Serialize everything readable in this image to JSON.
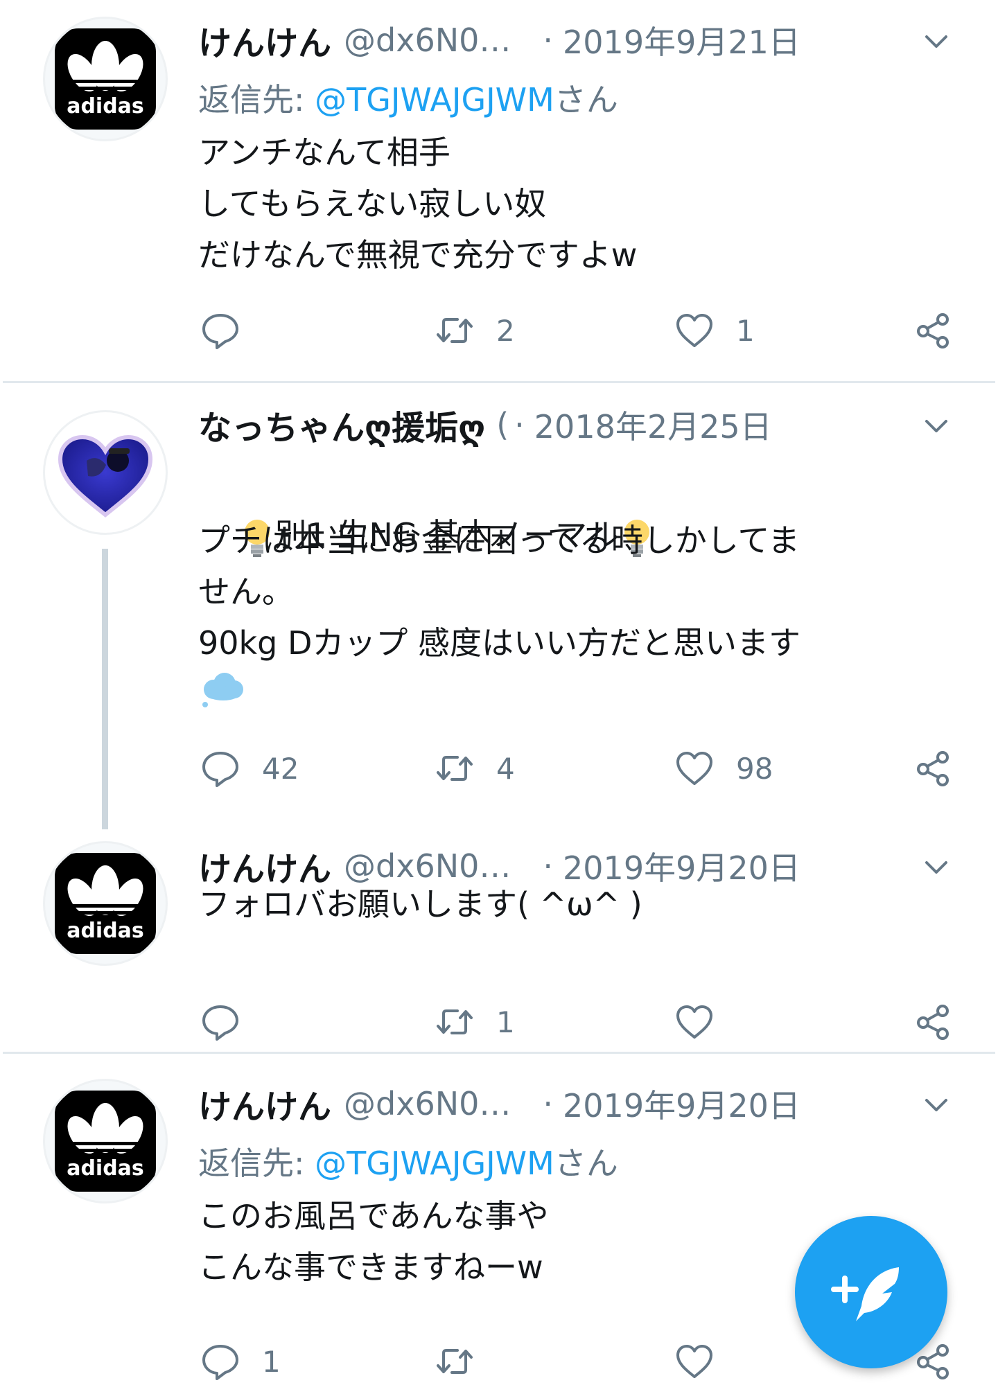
{
  "tweets": [
    {
      "name": "けんけん",
      "handle": "@dx6N0…",
      "dot": "·",
      "date": "2019年9月21日",
      "reply_prefix": "返信先: ",
      "reply_mention": "@TGJWAJGJWM",
      "reply_suffix": "さん",
      "text": "アンチなんて相手\nしてもらえない寂しい奴\nだけなんで無視で充分ですよw",
      "replies": "",
      "retweets": "2",
      "likes": "1",
      "avatar_text": "adidas"
    },
    {
      "name": "なっちゃんღ援垢ღ",
      "handle": "(",
      "dot": "·",
      "date": "2018年2月25日",
      "line1": "別1 生NG 基本ノーマル",
      "text": "プチは本当にお金に困ってる時しかしてま\nせん。\n90kg Dカップ 感度はいい方だと思います",
      "replies": "42",
      "retweets": "4",
      "likes": "98"
    },
    {
      "name": "けんけん",
      "handle": "@dx6N0…",
      "dot": "·",
      "date": "2019年9月20日",
      "text": "フォロバお願いします( ^ω^ )",
      "replies": "",
      "retweets": "1",
      "likes": "",
      "avatar_text": "adidas"
    },
    {
      "name": "けんけん",
      "handle": "@dx6N0…",
      "dot": "·",
      "date": "2019年9月20日",
      "reply_prefix": "返信先: ",
      "reply_mention": "@TGJWAJGJWM",
      "reply_suffix": "さん",
      "text": "このお風呂であんな事や\nこんな事できますねーw",
      "replies": "1",
      "retweets": "",
      "likes": "",
      "avatar_text": "adidas"
    }
  ],
  "icons": {
    "reply": "speech-bubble-icon",
    "retweet": "retweet-icon",
    "like": "heart-icon",
    "share": "share-icon",
    "more": "chevron-down-icon",
    "compose": "compose-feather-icon"
  },
  "colors": {
    "accent": "#1da1f2",
    "secondary_text": "#657786",
    "divider": "#e1e8ed"
  }
}
